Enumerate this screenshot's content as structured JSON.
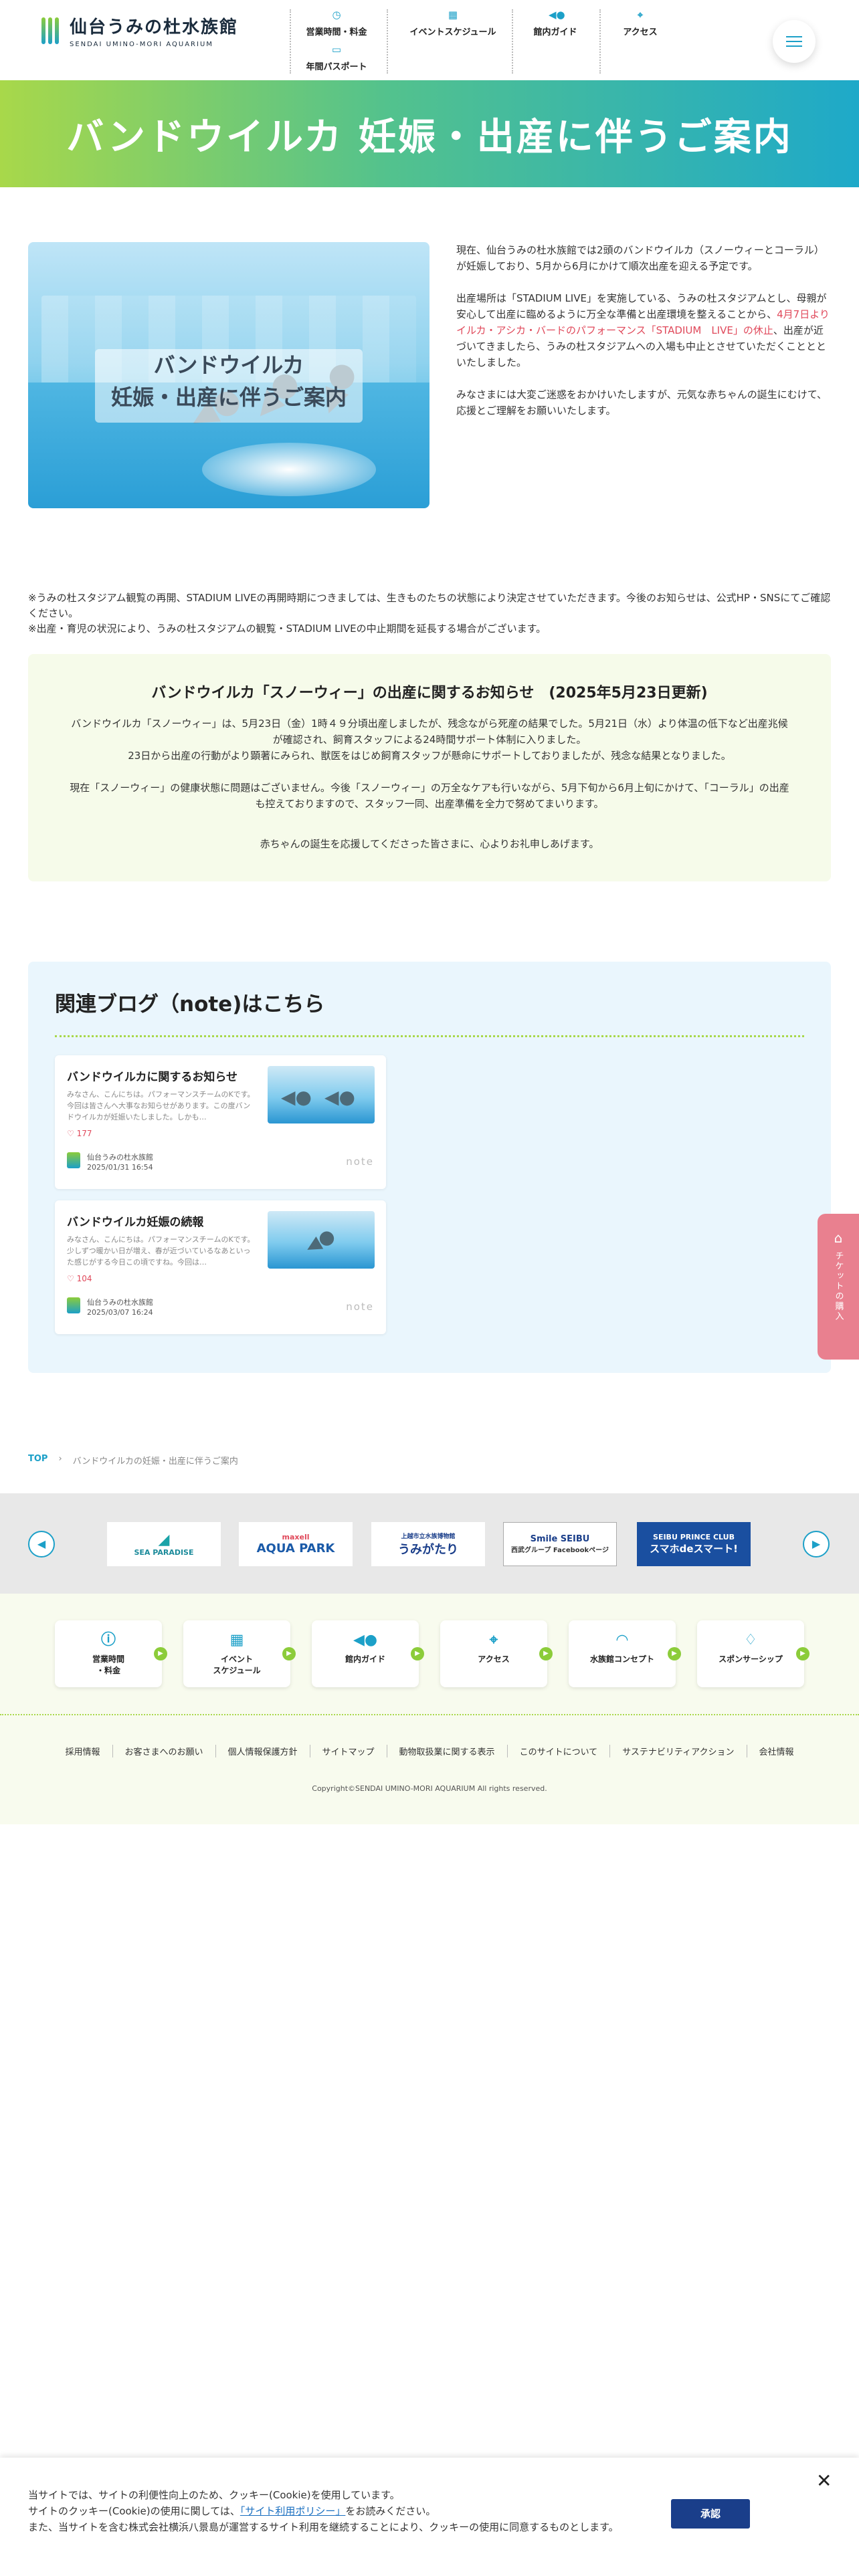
{
  "header": {
    "logo_jp": "仙台うみの杜水族館",
    "logo_en": "SENDAI UMINO-MORI AQUARIUM",
    "nav": [
      {
        "label": "営業時間・料金",
        "icon": "clock-icon"
      },
      {
        "label": "年間パスポート",
        "icon": "card-icon"
      },
      {
        "label": "イベントスケジュール",
        "icon": "calendar-icon"
      },
      {
        "label": "館内ガイド",
        "icon": "fish-icon"
      },
      {
        "label": "アクセス",
        "icon": "map-pin-icon"
      }
    ]
  },
  "hero": {
    "title": "バンドウイルカ 妊娠・出産に伴うご案内"
  },
  "intro": {
    "image_caption": "バンドウイルカ\n妊娠・出産に伴うご案内",
    "p1": "現在、仙台うみの杜水族館では2頭のバンドウイルカ（スノーウィーとコーラル）が妊娠しており、5月から6月にかけて順次出産を迎える予定です。",
    "p2_before": "出産場所は「STADIUM LIVE」を実施している、うみの杜スタジアムとし、母親が安心して出産に臨めるように万全な準備と出産環境を整えることから、",
    "p2_red": "4月7日よりイルカ・アシカ・バードのパフォーマンス「STADIUM　LIVE」の休止",
    "p2_after": "、出産が近づいてきましたら、うみの杜スタジアムへの入場も中止とさせていただくこととといたしました。",
    "p3": "みなさまには大変ご迷惑をおかけいたしますが、元気な赤ちゃんの誕生にむけて、応援とご理解をお願いいたします。"
  },
  "notes": {
    "n1": "※うみの杜スタジアム観覧の再開、STADIUM LIVEの再開時期につきましては、生きものたちの状態により決定させていただきます。今後のお知らせは、公式HP・SNSにてご確認ください。",
    "n2": "※出産・育児の状況により、うみの杜スタジアムの観覧・STADIUM LIVEの中止期間を延長する場合がございます。"
  },
  "news": {
    "title": "バンドウイルカ「スノーウィー」の出産に関するお知らせ　(2025年5月23日更新)",
    "p1": "バンドウイルカ「スノーウィー」は、5月23日（金）1時４９分頃出産しましたが、残念ながら死産の結果でした。5月21日（水）より体温の低下など出産兆候が確認され、飼育スタッフによる24時間サポート体制に入りました。",
    "p2": "23日から出産の行動がより顕著にみられ、獣医をはじめ飼育スタッフが懸命にサポートしておりましたが、残念な結果となりました。",
    "p3": "現在「スノーウィー」の健康状態に問題はございません。今後「スノーウィー」の万全なケアも行いながら、5月下旬から6月上旬にかけて、「コーラル」の出産も控えておりますので、スタッフ一同、出産準備を全力で努めてまいります。",
    "p4": "赤ちゃんの誕生を応援してくださった皆さまに、心よりお礼申しあげます。"
  },
  "blog": {
    "heading": "関連ブログ（note)はこちら",
    "cards": [
      {
        "title": "バンドウイルカに関するお知らせ",
        "excerpt": "みなさん、こんにちは。パフォーマンスチームのKです。今回は皆さんへ大事なお知らせがあります。この度バンドウイルカが妊娠いたしました。しかも…",
        "likes": "177",
        "author": "仙台うみの杜水族館",
        "date": "2025/01/31 16:54",
        "note": "note"
      },
      {
        "title": "バンドウイルカ妊娠の続報",
        "excerpt": "みなさん、こんにちは。パフォーマンスチームのKです。少しずつ暖かい日が増え、春が近づいているなあといった感じがする今日この頃ですね。今回は…",
        "likes": "104",
        "author": "仙台うみの杜水族館",
        "date": "2025/03/07 16:24",
        "note": "note"
      }
    ]
  },
  "ticket": {
    "label": "チケットの購入"
  },
  "breadcrumb": {
    "top": "TOP",
    "current": "バンドウイルカの妊娠・出産に伴うご案内"
  },
  "banners": [
    {
      "l1": "SEA PARADISE",
      "l2": ""
    },
    {
      "l1": "maxell",
      "l2": "AQUA PARK"
    },
    {
      "l1": "上越市立水族博物館",
      "l2": "うみがたり"
    },
    {
      "l1": "Smile SEIBU",
      "l2": "西武グループ Facebookページ"
    },
    {
      "l1": "SEIBU PRINCE CLUB",
      "l2": "スマホdeスマート!"
    }
  ],
  "footer_nav": [
    {
      "label": "営業時間\n・料金",
      "icon": "clock-icon"
    },
    {
      "label": "イベント\nスケジュール",
      "icon": "calendar-icon"
    },
    {
      "label": "館内ガイド",
      "icon": "fish-icon"
    },
    {
      "label": "アクセス",
      "icon": "map-pin-icon"
    },
    {
      "label": "水族館コンセプト",
      "icon": "dolphin-icon"
    },
    {
      "label": "スポンサーシップ",
      "icon": "handshake-icon"
    }
  ],
  "footer_links": [
    "採用情報",
    "お客さまへのお願い",
    "個人情報保護方針",
    "サイトマップ",
    "動物取扱業に関する表示",
    "このサイトについて",
    "サステナビリティアクション",
    "会社情報"
  ],
  "copyright": "Copyright©SENDAI UMINO-MORI AQUARIUM All rights reserved.",
  "cookie": {
    "l1": "当サイトでは、サイトの利便性向上のため、クッキー(Cookie)を使用しています。",
    "l2_before": "サイトのクッキー(Cookie)の使用に関しては、",
    "l2_link": "「サイト利用ポリシー」",
    "l2_after": "をお読みください。",
    "l3": "また、当サイトを含む株式会社横浜八景島が運営するサイト利用を継続することにより、クッキーの使用に同意するものとします。",
    "accept": "承認",
    "close": "✕"
  },
  "colors": {
    "accent": "#1ca0c8",
    "green": "#8ccc3a",
    "red": "#e0485a",
    "ticket": "#e9808f",
    "accept": "#1a3e8a"
  }
}
